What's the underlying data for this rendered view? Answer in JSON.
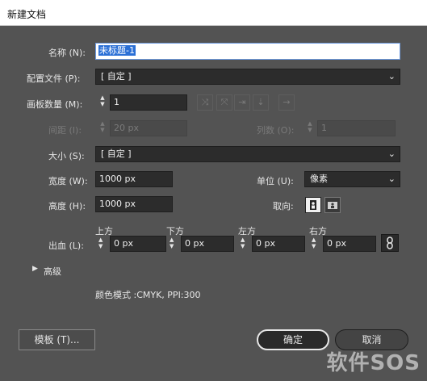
{
  "window": {
    "title": "新建文档"
  },
  "fields": {
    "name_label": "名称 (N):",
    "name_value": "未标题-1",
    "profile_label": "配置文件 (P):",
    "profile_value": "[ 自定 ]",
    "artboards_label": "画板数量 (M):",
    "artboards_value": "1",
    "spacing_label": "间距 (I):",
    "spacing_value": "20 px",
    "columns_label": "列数 (O):",
    "columns_value": "1",
    "size_label": "大小 (S):",
    "size_value": "[ 自定 ]",
    "width_label": "宽度 (W):",
    "width_value": "1000 px",
    "units_label": "单位 (U):",
    "units_value": "像素",
    "height_label": "高度 (H):",
    "height_value": "1000 px",
    "orientation_label": "取向:"
  },
  "bleed": {
    "label": "出血 (L):",
    "top_label": "上方",
    "top_value": "0 px",
    "bottom_label": "下方",
    "bottom_value": "0 px",
    "left_label": "左方",
    "left_value": "0 px",
    "right_label": "右方",
    "right_value": "0 px"
  },
  "advanced": {
    "label": "高级",
    "color_mode": "颜色模式 :CMYK, PPI:300"
  },
  "buttons": {
    "templates": "模板 (T)...",
    "ok": "确定",
    "cancel": "取消"
  },
  "watermark": "软件SOS",
  "colors": {
    "dialog_bg": "#535353",
    "field_bg": "#2c2c2c",
    "titlebar_bg": "#ffffff",
    "selection": "#2a6fd6"
  }
}
